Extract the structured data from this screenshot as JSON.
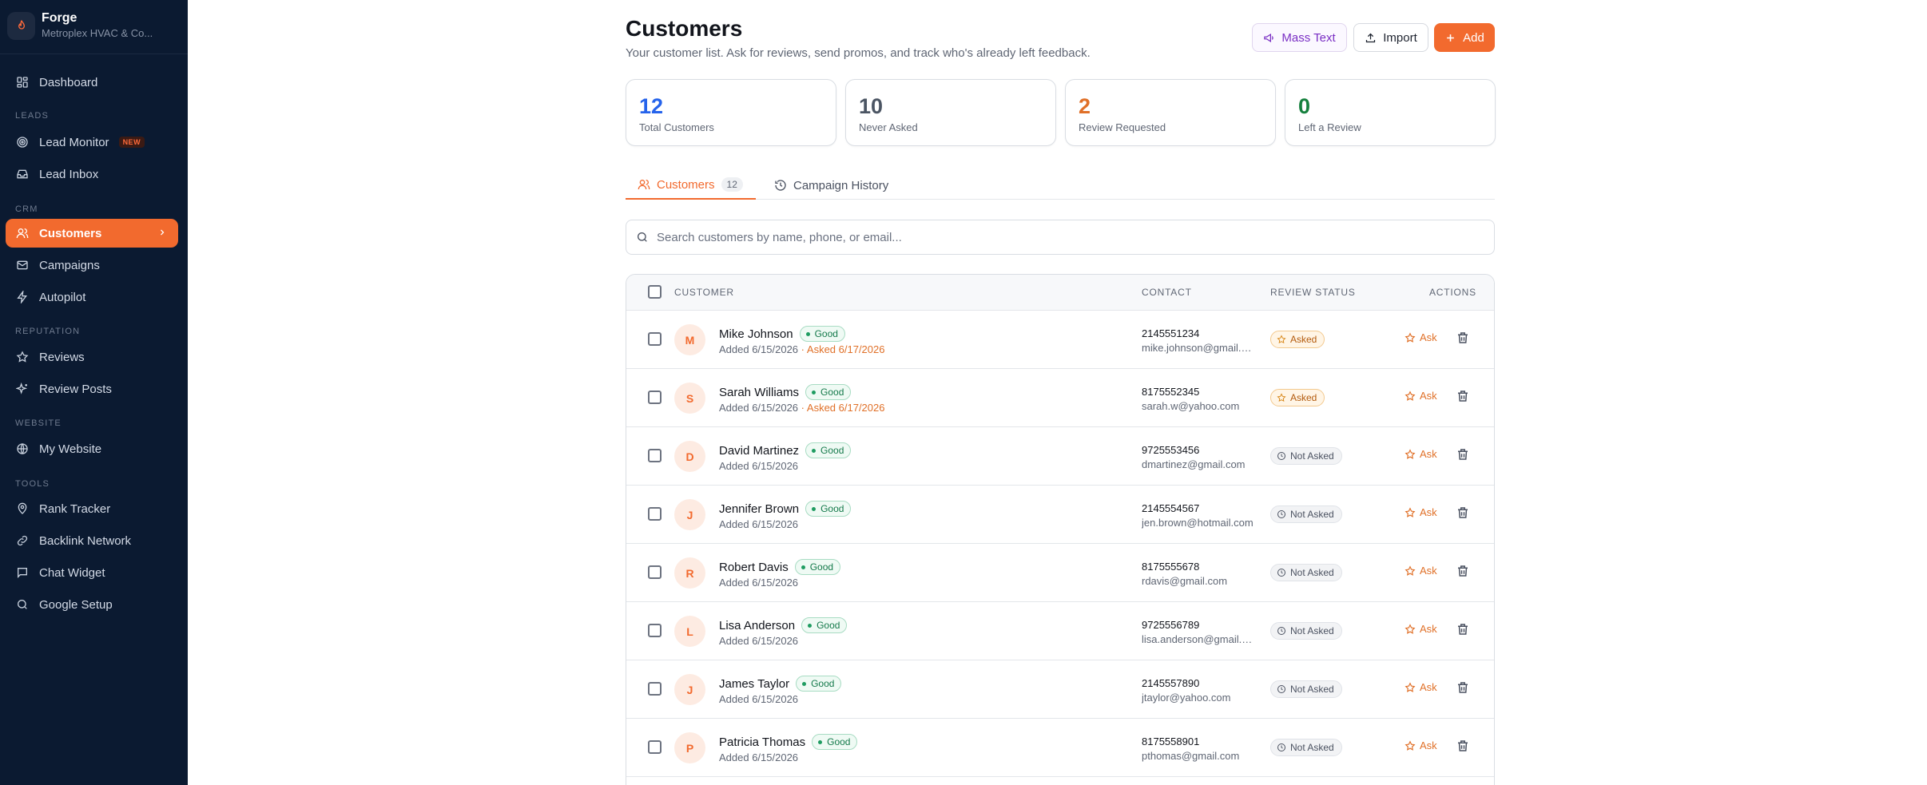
{
  "brand": {
    "name": "Forge",
    "subtitle": "Metroplex HVAC & Co..."
  },
  "sidebar": {
    "dashboard": "Dashboard",
    "sections": {
      "leads": "LEADS",
      "crm": "CRM",
      "reputation": "REPUTATION",
      "website": "WEBSITE",
      "tools": "TOOLS"
    },
    "lead_monitor": "Lead Monitor",
    "new_badge": "NEW",
    "lead_inbox": "Lead Inbox",
    "customers": "Customers",
    "campaigns": "Campaigns",
    "autopilot": "Autopilot",
    "reviews": "Reviews",
    "review_posts": "Review Posts",
    "my_website": "My Website",
    "rank_tracker": "Rank Tracker",
    "backlink_network": "Backlink Network",
    "chat_widget": "Chat Widget",
    "google_setup": "Google Setup"
  },
  "header": {
    "title": "Customers",
    "subtitle": "Your customer list. Ask for reviews, send promos, and track who's already left feedback.",
    "mass_text": "Mass Text",
    "import": "Import",
    "add": "Add"
  },
  "stats": [
    {
      "value": "12",
      "label": "Total Customers",
      "color": "#2563eb"
    },
    {
      "value": "10",
      "label": "Never Asked",
      "color": "#4b5563"
    },
    {
      "value": "2",
      "label": "Review Requested",
      "color": "#e07028"
    },
    {
      "value": "0",
      "label": "Left a Review",
      "color": "#15803d"
    }
  ],
  "tabs": {
    "customers": "Customers",
    "customers_count": "12",
    "history": "Campaign History"
  },
  "search": {
    "placeholder": "Search customers by name, phone, or email..."
  },
  "table": {
    "headers": {
      "customer": "CUSTOMER",
      "contact": "CONTACT",
      "review_status": "REVIEW STATUS",
      "actions": "ACTIONS"
    },
    "good_label": "Good",
    "ask_label": "Ask",
    "rows": [
      {
        "initial": "M",
        "name": "Mike Johnson",
        "added": "Added 6/15/2026",
        "asked": "· Asked 6/17/2026",
        "phone": "2145551234",
        "email": "mike.johnson@gmail.com",
        "status": "Asked"
      },
      {
        "initial": "S",
        "name": "Sarah Williams",
        "added": "Added 6/15/2026",
        "asked": "· Asked 6/17/2026",
        "phone": "8175552345",
        "email": "sarah.w@yahoo.com",
        "status": "Asked"
      },
      {
        "initial": "D",
        "name": "David Martinez",
        "added": "Added 6/15/2026",
        "asked": "",
        "phone": "9725553456",
        "email": "dmartinez@gmail.com",
        "status": "Not Asked"
      },
      {
        "initial": "J",
        "name": "Jennifer Brown",
        "added": "Added 6/15/2026",
        "asked": "",
        "phone": "2145554567",
        "email": "jen.brown@hotmail.com",
        "status": "Not Asked"
      },
      {
        "initial": "R",
        "name": "Robert Davis",
        "added": "Added 6/15/2026",
        "asked": "",
        "phone": "8175555678",
        "email": "rdavis@gmail.com",
        "status": "Not Asked"
      },
      {
        "initial": "L",
        "name": "Lisa Anderson",
        "added": "Added 6/15/2026",
        "asked": "",
        "phone": "9725556789",
        "email": "lisa.anderson@gmail.com",
        "status": "Not Asked"
      },
      {
        "initial": "J",
        "name": "James Taylor",
        "added": "Added 6/15/2026",
        "asked": "",
        "phone": "2145557890",
        "email": "jtaylor@yahoo.com",
        "status": "Not Asked"
      },
      {
        "initial": "P",
        "name": "Patricia Thomas",
        "added": "Added 6/15/2026",
        "asked": "",
        "phone": "8175558901",
        "email": "pthomas@gmail.com",
        "status": "Not Asked"
      }
    ]
  },
  "colors": {
    "accent": "#f26a2e",
    "sidebar_bg": "#0b1a31",
    "mass_text": "#7a2fc4"
  }
}
